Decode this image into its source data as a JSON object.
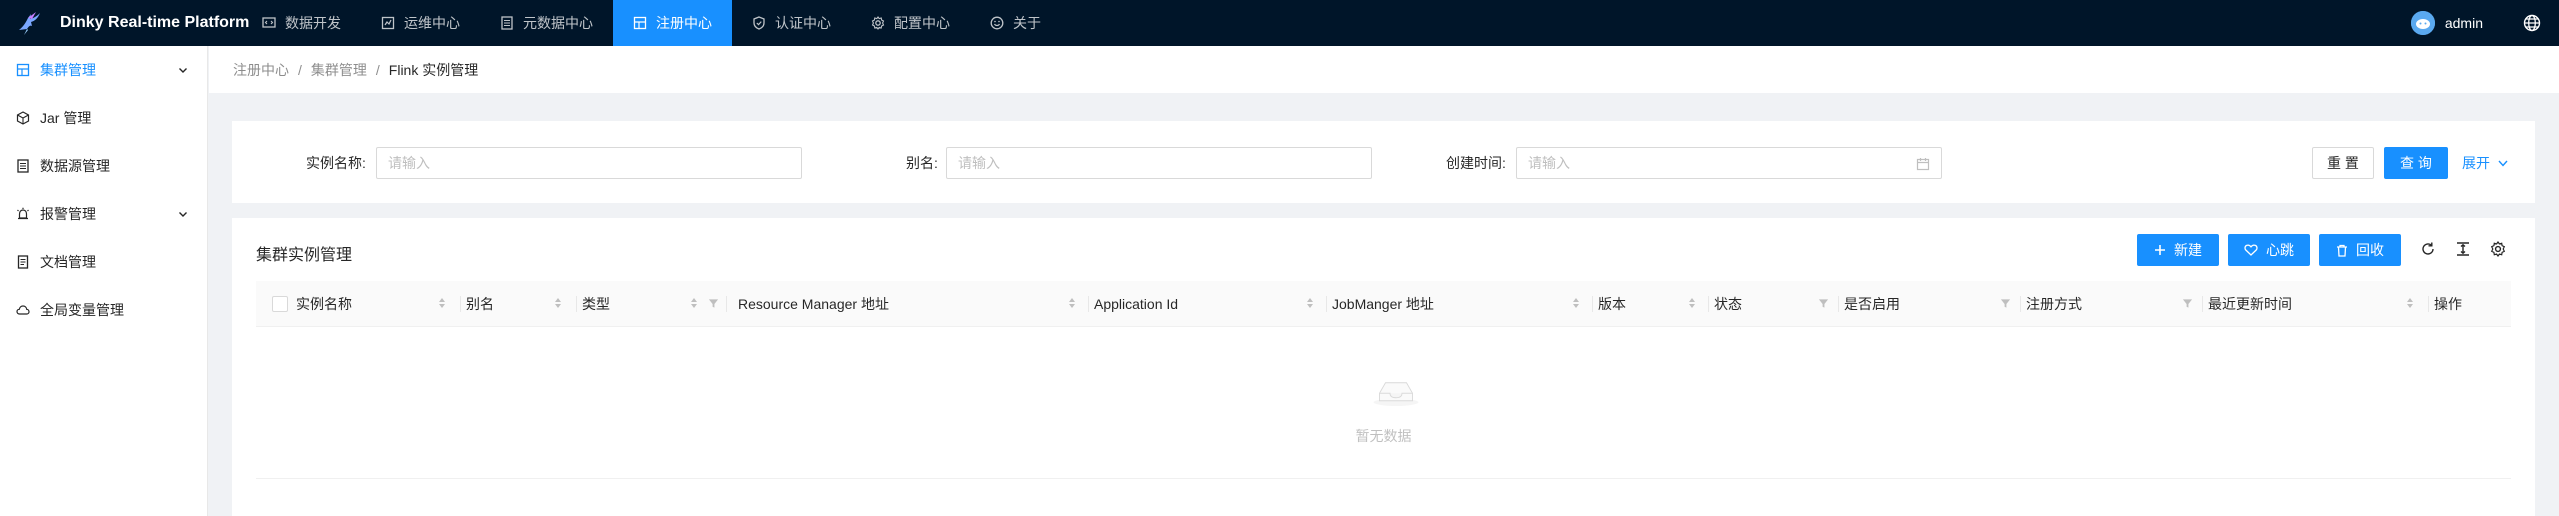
{
  "header": {
    "title": "Dinky Real-time Platform",
    "nav": [
      {
        "label": "数据开发",
        "icon": "code-icon"
      },
      {
        "label": "运维中心",
        "icon": "dashboard-icon"
      },
      {
        "label": "元数据中心",
        "icon": "database-icon"
      },
      {
        "label": "注册中心",
        "icon": "cluster-icon",
        "active": true
      },
      {
        "label": "认证中心",
        "icon": "shield-icon"
      },
      {
        "label": "配置中心",
        "icon": "gear-icon"
      },
      {
        "label": "关于",
        "icon": "smile-icon"
      }
    ],
    "user": "admin"
  },
  "sidebar": {
    "items": [
      {
        "label": "集群管理",
        "icon": "cluster-icon",
        "active": true,
        "expandable": true
      },
      {
        "label": "Jar 管理",
        "icon": "code-sandbox-icon"
      },
      {
        "label": "数据源管理",
        "icon": "database-icon"
      },
      {
        "label": "报警管理",
        "icon": "alert-icon",
        "expandable": true
      },
      {
        "label": "文档管理",
        "icon": "file-icon"
      },
      {
        "label": "全局变量管理",
        "icon": "cloud-icon"
      }
    ]
  },
  "breadcrumb": [
    "注册中心",
    "集群管理",
    "Flink 实例管理"
  ],
  "search": {
    "name_label": "实例名称:",
    "name_placeholder": "请输入",
    "alias_label": "别名:",
    "alias_placeholder": "请输入",
    "time_label": "创建时间:",
    "time_placeholder": "请输入",
    "reset_label": "重 置",
    "query_label": "查 询",
    "expand_label": "展开"
  },
  "table": {
    "title": "集群实例管理",
    "new_label": "新建",
    "heartbeat_label": "心跳",
    "recycle_label": "回收",
    "columns": [
      "实例名称",
      "别名",
      "类型",
      "Resource Manager 地址",
      "Application Id",
      "JobManger 地址",
      "版本",
      "状态",
      "是否启用",
      "注册方式",
      "最近更新时间",
      "操作"
    ],
    "empty_text": "暂无数据"
  },
  "colors": {
    "primary": "#1890ff",
    "header_bg": "#001529"
  }
}
